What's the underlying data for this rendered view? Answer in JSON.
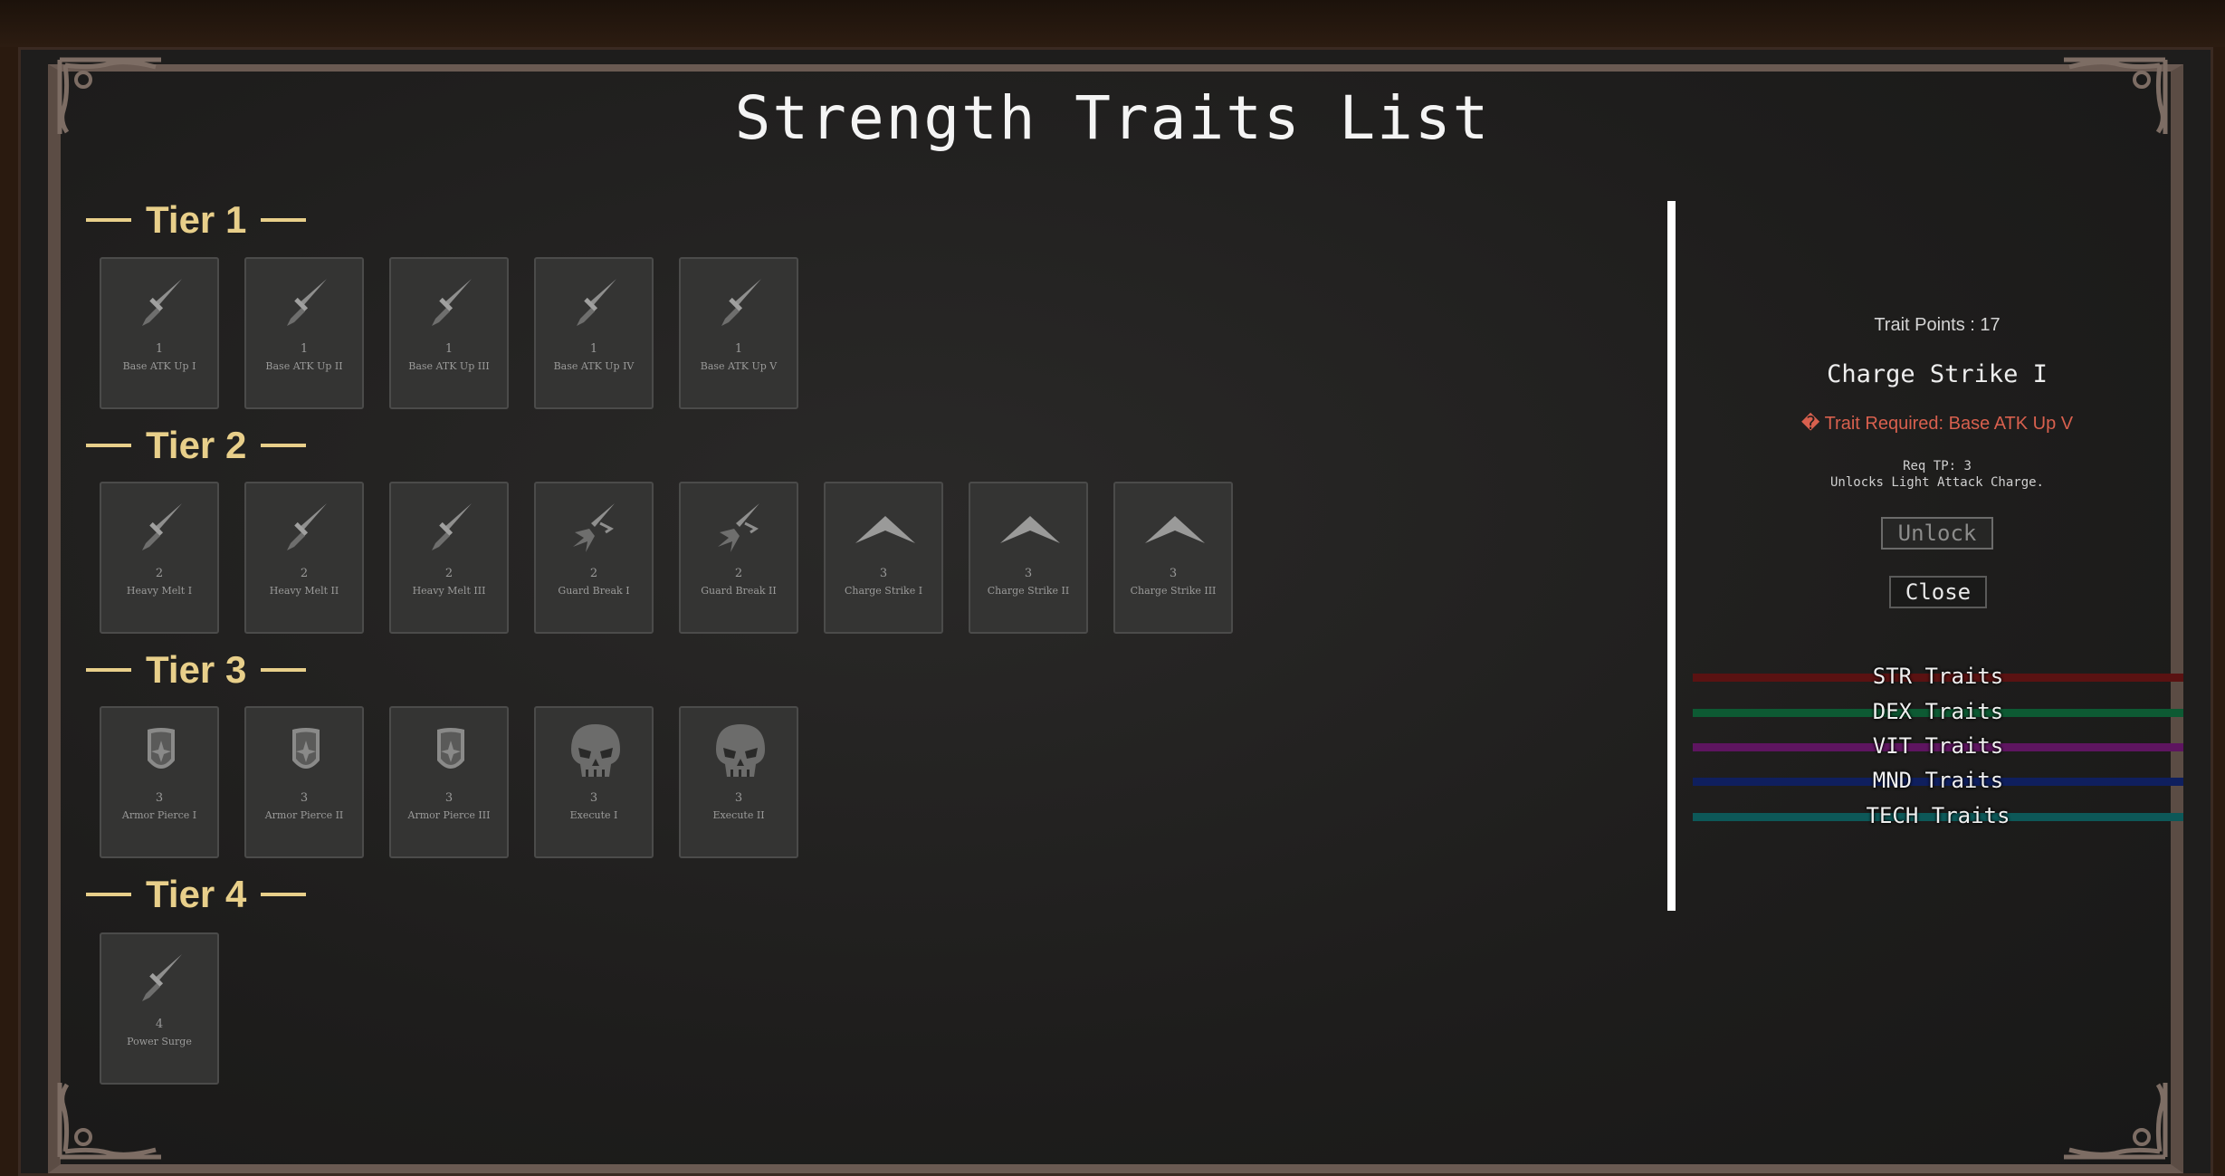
{
  "page": {
    "title": "Strength Traits List"
  },
  "tiers": [
    {
      "label": "Tier 1",
      "traits": [
        {
          "cost": "1",
          "name": "Base ATK Up I",
          "icon": "dagger-icon"
        },
        {
          "cost": "1",
          "name": "Base ATK Up II",
          "icon": "dagger-icon"
        },
        {
          "cost": "1",
          "name": "Base ATK Up III",
          "icon": "dagger-icon"
        },
        {
          "cost": "1",
          "name": "Base ATK Up IV",
          "icon": "dagger-icon"
        },
        {
          "cost": "1",
          "name": "Base ATK Up V",
          "icon": "dagger-icon"
        }
      ]
    },
    {
      "label": "Tier 2",
      "traits": [
        {
          "cost": "2",
          "name": "Heavy Melt I",
          "icon": "dagger-icon"
        },
        {
          "cost": "2",
          "name": "Heavy Melt II",
          "icon": "dagger-icon"
        },
        {
          "cost": "2",
          "name": "Heavy Melt III",
          "icon": "dagger-icon"
        },
        {
          "cost": "2",
          "name": "Guard Break I",
          "icon": "broken-blade-icon"
        },
        {
          "cost": "2",
          "name": "Guard Break II",
          "icon": "broken-blade-icon"
        },
        {
          "cost": "3",
          "name": "Charge Strike I",
          "icon": "chevron-up-icon"
        },
        {
          "cost": "3",
          "name": "Charge Strike II",
          "icon": "chevron-up-icon"
        },
        {
          "cost": "3",
          "name": "Charge Strike III",
          "icon": "chevron-up-icon"
        }
      ]
    },
    {
      "label": "Tier 3",
      "traits": [
        {
          "cost": "3",
          "name": "Armor Pierce I",
          "icon": "shield-icon"
        },
        {
          "cost": "3",
          "name": "Armor Pierce II",
          "icon": "shield-icon"
        },
        {
          "cost": "3",
          "name": "Armor Pierce III",
          "icon": "shield-icon"
        },
        {
          "cost": "3",
          "name": "Execute I",
          "icon": "skull-icon"
        },
        {
          "cost": "3",
          "name": "Execute II",
          "icon": "skull-icon"
        }
      ]
    },
    {
      "label": "Tier 4",
      "traits": [
        {
          "cost": "4",
          "name": "Power Surge",
          "icon": "dagger-icon"
        }
      ]
    }
  ],
  "detail": {
    "trait_points": "Trait Points : 17",
    "title": "Charge Strike I",
    "required": "� Trait Required: Base ATK Up V",
    "req_tp": "Req TP: 3",
    "description": "Unlocks Light Attack Charge.",
    "unlock_label": "Unlock",
    "close_label": "Close"
  },
  "categories": [
    {
      "label": "STR Traits",
      "color": "#5a1212"
    },
    {
      "label": "DEX Traits",
      "color": "#0d5a33"
    },
    {
      "label": "VIT Traits",
      "color": "#5e1560"
    },
    {
      "label": "MND Traits",
      "color": "#0f1f5e"
    },
    {
      "label": "TECH Traits",
      "color": "#0d5858"
    }
  ],
  "colors": {
    "tier_gold": "#e8cf8a",
    "required_red": "#d8604e",
    "card_bg": "#343433"
  }
}
